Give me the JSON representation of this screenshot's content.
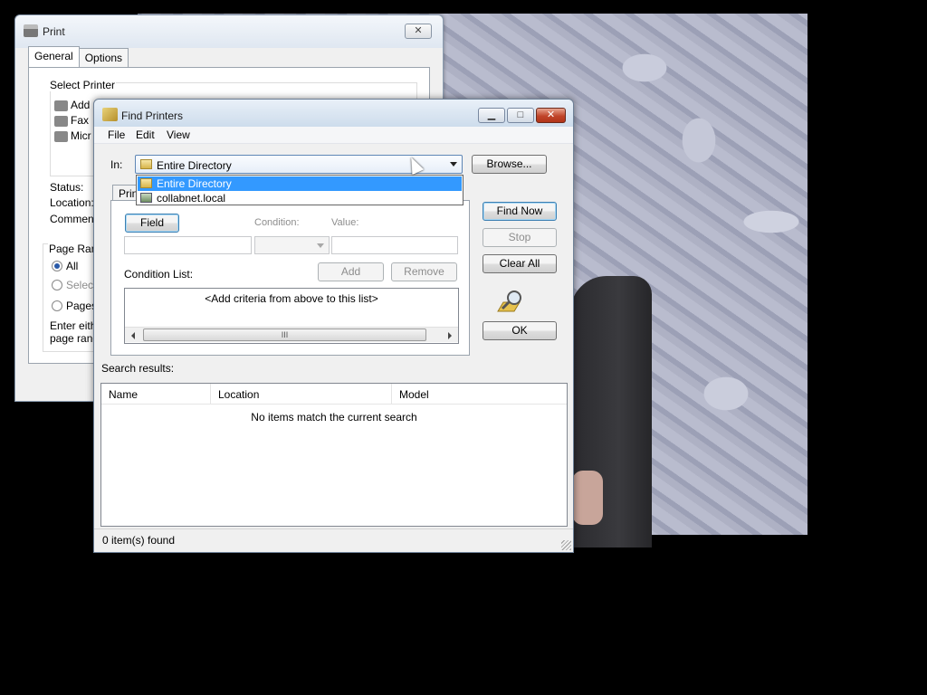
{
  "print_window": {
    "title": "Print",
    "close": "✕",
    "tabs": [
      {
        "label": "General"
      },
      {
        "label": "Options"
      }
    ],
    "select_printer_label": "Select Printer",
    "printers": [
      {
        "label": "Add"
      },
      {
        "label": "Fax"
      },
      {
        "label": "Micr"
      }
    ],
    "status_label": "Status:",
    "location_label": "Location:",
    "comment_label": "Comment:",
    "page_range_label": "Page Rang",
    "radios": [
      {
        "label": "All",
        "checked": true
      },
      {
        "label": "Selectio",
        "checked": false
      },
      {
        "label": "Pages",
        "checked": false
      }
    ],
    "hint_line1": "Enter eithe",
    "hint_line2": "page rang"
  },
  "find_printers": {
    "title": "Find Printers",
    "window_buttons": {
      "minimize": "▁",
      "maximize": "□",
      "close": "✕"
    },
    "menu": [
      {
        "label": "File"
      },
      {
        "label": "Edit"
      },
      {
        "label": "View"
      }
    ],
    "in_label": "In:",
    "in_value": "Entire Directory",
    "dropdown_options": [
      {
        "label": "Entire Directory",
        "selected": true
      },
      {
        "label": "collabnet.local",
        "selected": false
      }
    ],
    "browse_button": "Browse...",
    "tab_label": "Printers",
    "field_button": "Field",
    "condition_label": "Condition:",
    "value_label": "Value:",
    "condition_list_label": "Condition List:",
    "add_button": "Add",
    "remove_button": "Remove",
    "condition_list_empty": "<Add criteria from above to this list>",
    "scroll_thumb": "III",
    "find_now_button": "Find Now",
    "stop_button": "Stop",
    "clear_all_button": "Clear All",
    "ok_button": "OK",
    "search_results_label": "Search results:",
    "columns": [
      {
        "label": "Name"
      },
      {
        "label": "Location"
      },
      {
        "label": "Model"
      }
    ],
    "results_empty": "No items match the current search",
    "status": "0 item(s) found"
  }
}
